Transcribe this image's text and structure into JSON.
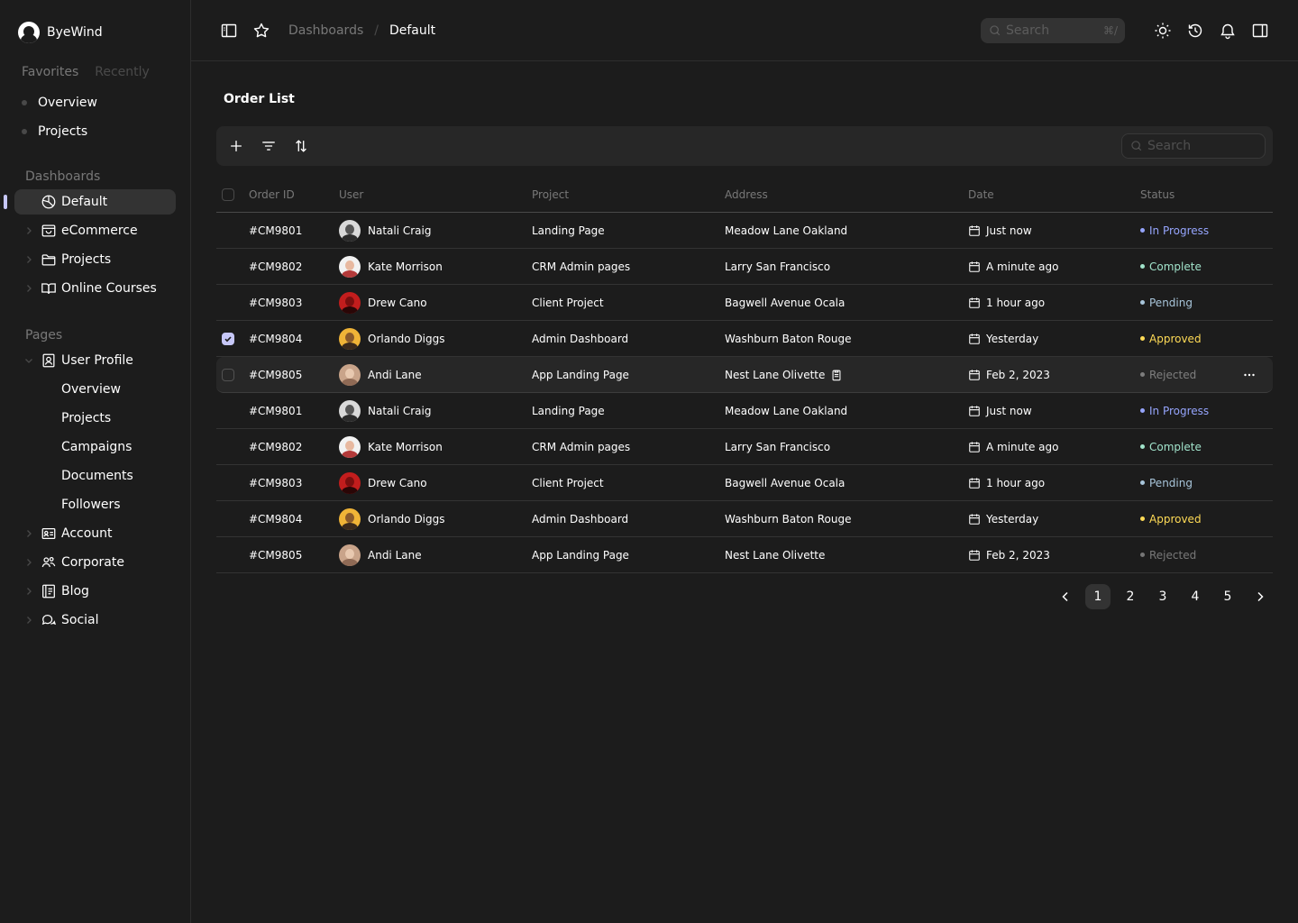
{
  "brand": {
    "name": "ByeWind"
  },
  "sidebar": {
    "tabs": {
      "favorites": "Favorites",
      "recently": "Recently"
    },
    "favorites": [
      {
        "label": "Overview"
      },
      {
        "label": "Projects"
      }
    ],
    "dashboards_title": "Dashboards",
    "dashboards": [
      {
        "label": "Default",
        "icon": "chart-pie-icon",
        "selected": true
      },
      {
        "label": "eCommerce",
        "icon": "shopping-bag-icon"
      },
      {
        "label": "Projects",
        "icon": "folder-icon"
      },
      {
        "label": "Online Courses",
        "icon": "book-open-icon"
      }
    ],
    "pages_title": "Pages",
    "pages": {
      "user_profile": "User Profile",
      "sub": [
        "Overview",
        "Projects",
        "Campaigns",
        "Documents",
        "Followers"
      ],
      "account": "Account",
      "corporate": "Corporate",
      "blog": "Blog",
      "social": "Social"
    }
  },
  "topbar": {
    "breadcrumb": {
      "parent": "Dashboards",
      "separator": "/",
      "current": "Default"
    },
    "search": {
      "placeholder": "Search",
      "shortcut": "⌘/"
    }
  },
  "main": {
    "title": "Order List",
    "search_placeholder": "Search",
    "columns": [
      "Order ID",
      "User",
      "Project",
      "Address",
      "Date",
      "Status"
    ],
    "rows": [
      {
        "id": "#CM9801",
        "user": "Natali Craig",
        "project": "Landing Page",
        "address": "Meadow Lane Oakland",
        "date": "Just now",
        "status": "In Progress"
      },
      {
        "id": "#CM9802",
        "user": "Kate Morrison",
        "project": "CRM Admin pages",
        "address": "Larry San Francisco",
        "date": "A minute ago",
        "status": "Complete"
      },
      {
        "id": "#CM9803",
        "user": "Drew Cano",
        "project": "Client Project",
        "address": "Bagwell Avenue Ocala",
        "date": "1 hour ago",
        "status": "Pending"
      },
      {
        "id": "#CM9804",
        "user": "Orlando Diggs",
        "project": "Admin Dashboard",
        "address": "Washburn Baton Rouge",
        "date": "Yesterday",
        "status": "Approved",
        "checked": true
      },
      {
        "id": "#CM9805",
        "user": "Andi Lane",
        "project": "App Landing Page",
        "address": "Nest Lane Olivette",
        "date": "Feb 2, 2023",
        "status": "Rejected",
        "hover": true
      },
      {
        "id": "#CM9801",
        "user": "Natali Craig",
        "project": "Landing Page",
        "address": "Meadow Lane Oakland",
        "date": "Just now",
        "status": "In Progress"
      },
      {
        "id": "#CM9802",
        "user": "Kate Morrison",
        "project": "CRM Admin pages",
        "address": "Larry San Francisco",
        "date": "A minute ago",
        "status": "Complete"
      },
      {
        "id": "#CM9803",
        "user": "Drew Cano",
        "project": "Client Project",
        "address": "Bagwell Avenue Ocala",
        "date": "1 hour ago",
        "status": "Pending"
      },
      {
        "id": "#CM9804",
        "user": "Orlando Diggs",
        "project": "Admin Dashboard",
        "address": "Washburn Baton Rouge",
        "date": "Yesterday",
        "status": "Approved"
      },
      {
        "id": "#CM9805",
        "user": "Andi Lane",
        "project": "App Landing Page",
        "address": "Nest Lane Olivette",
        "date": "Feb 2, 2023",
        "status": "Rejected"
      }
    ],
    "status_colors": {
      "In Progress": "#95a4fc",
      "Complete": "#a1e3cb",
      "Pending": "#a8c5da",
      "Approved": "#ffdb56",
      "Rejected": "#ffffff66"
    },
    "avatar_colors": {
      "Natali Craig": [
        "#d9d9d9",
        "#555555",
        "#2b2b2b"
      ],
      "Kate Morrison": [
        "#f2f2f2",
        "#e8b9a0",
        "#b33a3a"
      ],
      "Drew Cano": [
        "#c21d1d",
        "#7a0f0f",
        "#2a0606"
      ],
      "Orlando Diggs": [
        "#f0b437",
        "#8a5a2b",
        "#3b2a1c"
      ],
      "Andi Lane": [
        "#c9a48a",
        "#e8c9b0",
        "#8f6a55"
      ]
    },
    "pagination": [
      "1",
      "2",
      "3",
      "4",
      "5"
    ],
    "current_page": "1"
  }
}
